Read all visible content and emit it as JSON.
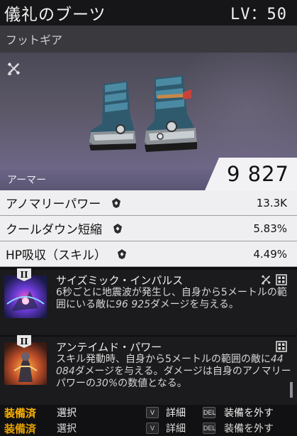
{
  "header": {
    "title": "儀礼のブーツ",
    "level": "LV：50"
  },
  "category": "フットギア",
  "icons": {
    "mod_slot": "wrench-screwdriver-icon",
    "attribute": "shield-diamond-icon",
    "grid": "grid-icon"
  },
  "armor": {
    "label": "アーマー",
    "value": "9 827"
  },
  "stats": [
    {
      "name": "アノマリーパワー",
      "value": "13.3K"
    },
    {
      "name": "クールダウン短縮",
      "value": "5.83%"
    },
    {
      "name": "HP吸収（スキル）",
      "value": "4.49%"
    }
  ],
  "talents": [
    {
      "rank": "II",
      "name": "サイズミック・インパルス",
      "desc_1": "6秒ごとに地震波が発生し、自身から5メートルの範囲にいる敵に",
      "desc_num": "96 925",
      "desc_2": "ダメージを与える。"
    },
    {
      "rank": "II",
      "name": "アンテイムド・パワー",
      "desc_1": "スキル発動時、自身から5メートルの範囲の敵に",
      "desc_num": "44 084",
      "desc_2": "ダメージを与える。ダメージは自身のアノマリーパワーの",
      "desc_num2": "30%",
      "desc_3": "の数値となる。"
    }
  ],
  "footer": {
    "equipped": "装備済",
    "select": "選択",
    "key_v": "V",
    "detail": "詳細",
    "key_del": "DEL",
    "unequip": "装備を外す"
  },
  "colors": {
    "accent": "#ffb300",
    "panel": "#6b6486",
    "stat_bg": "#efeff1"
  }
}
